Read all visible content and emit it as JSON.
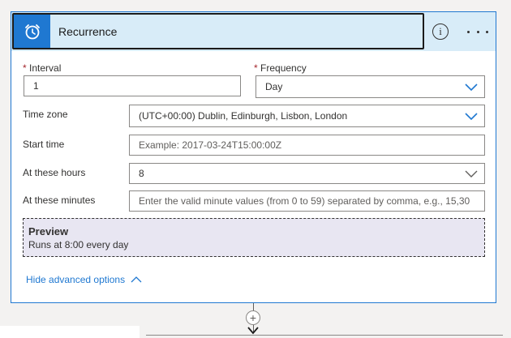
{
  "card": {
    "title": "Recurrence",
    "info_glyph": "i",
    "icons": {
      "trigger": "alarm-clock-icon",
      "info": "info-icon",
      "more": "more-options-icon"
    }
  },
  "fields": {
    "interval": {
      "label": "Interval",
      "required_marker": "*",
      "value": "1"
    },
    "frequency": {
      "label": "Frequency",
      "required_marker": "*",
      "value": "Day"
    },
    "time_zone": {
      "label": "Time zone",
      "value": "(UTC+00:00) Dublin, Edinburgh, Lisbon, London"
    },
    "start_time": {
      "label": "Start time",
      "placeholder": "Example: 2017-03-24T15:00:00Z"
    },
    "hours": {
      "label": "At these hours",
      "value": "8"
    },
    "minutes": {
      "label": "At these minutes",
      "placeholder": "Enter the valid minute values (from 0 to 59) separated by comma, e.g., 15,30"
    }
  },
  "preview": {
    "title": "Preview",
    "text": "Runs at 8:00 every day"
  },
  "advanced": {
    "label": "Hide advanced options"
  },
  "connector": {
    "plus_glyph": "+"
  },
  "colors": {
    "accent": "#1f78d1",
    "header_bg": "#d8ecf8",
    "preview_bg": "#e8e6f2",
    "required": "#a4262c"
  }
}
